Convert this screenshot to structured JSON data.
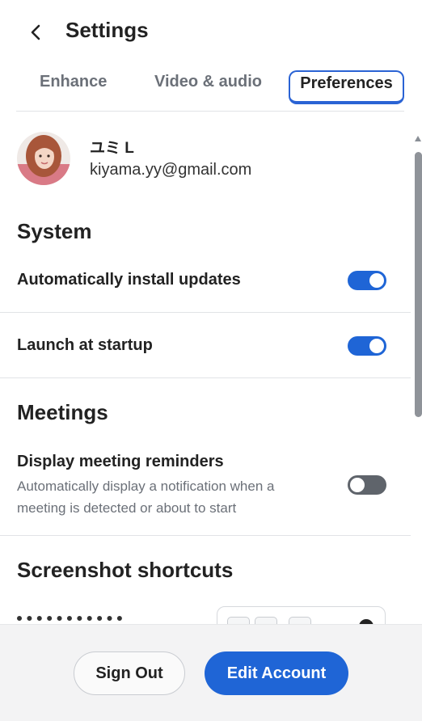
{
  "header": {
    "title": "Settings",
    "back_icon": "chevron-left-icon"
  },
  "tabs": [
    {
      "label": "Enhance",
      "active": false
    },
    {
      "label": "Video & audio",
      "active": false
    },
    {
      "label": "Preferences",
      "active": true
    }
  ],
  "account": {
    "name": "ユミ L",
    "email": "kiyama.yy@gmail.com"
  },
  "sections": {
    "system": {
      "title": "System",
      "items": [
        {
          "label": "Automatically install updates",
          "enabled": true
        },
        {
          "label": "Launch at startup",
          "enabled": true
        }
      ]
    },
    "meetings": {
      "title": "Meetings",
      "items": [
        {
          "label": "Display meeting reminders",
          "description": "Automatically display a notification when a meeting is detected or about to start",
          "enabled": false
        }
      ]
    },
    "screenshot": {
      "title": "Screenshot shortcuts"
    }
  },
  "footer": {
    "sign_out_label": "Sign Out",
    "edit_account_label": "Edit Account"
  },
  "colors": {
    "accent": "#1f65d6",
    "toggle_off": "#5f646b"
  }
}
